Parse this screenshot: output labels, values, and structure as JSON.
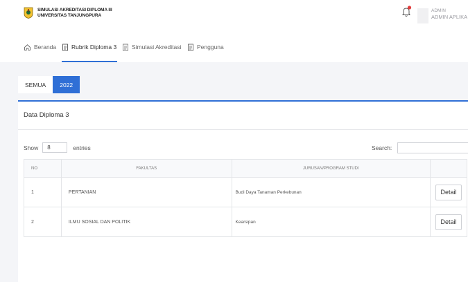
{
  "header": {
    "brand_line1": "SIMULASI AKREDITASI DIPLOMA III",
    "brand_line2": "UNIVERSITAS TANJUNGPURA",
    "user_role": "ADMIN",
    "user_name": "ADMIN APLIKA"
  },
  "nav": {
    "items": [
      {
        "label": "Beranda",
        "icon": "home-icon"
      },
      {
        "label": "Rubrik Diploma 3",
        "icon": "document-icon"
      },
      {
        "label": "Simulasi Akreditasi",
        "icon": "document-icon"
      },
      {
        "label": "Pengguna",
        "icon": "document-icon"
      }
    ],
    "active": "Rubrik Diploma 3"
  },
  "tabs": [
    "SEMUA",
    "2022"
  ],
  "active_tab": "2022",
  "colors": {
    "accent": "#2f6fd6",
    "notification": "#e23b3b"
  },
  "card": {
    "title": "Data Diploma 3",
    "show_label": "Show",
    "entries_value": "8",
    "entries_label": "entries",
    "search_label": "Search:"
  },
  "table": {
    "headers": [
      "NO",
      "FAKULTAS",
      "JURUSAN/PROGRAM STUDI",
      ""
    ],
    "rows": [
      {
        "no": "1",
        "fakultas": "PERTANIAN",
        "prodi": "Budi Daya Tanaman Perkebunan",
        "action": "Detail"
      },
      {
        "no": "2",
        "fakultas": "ILMU SOSIAL DAN POLITIK",
        "prodi": "Kearsipan",
        "action": "Detail"
      }
    ]
  }
}
